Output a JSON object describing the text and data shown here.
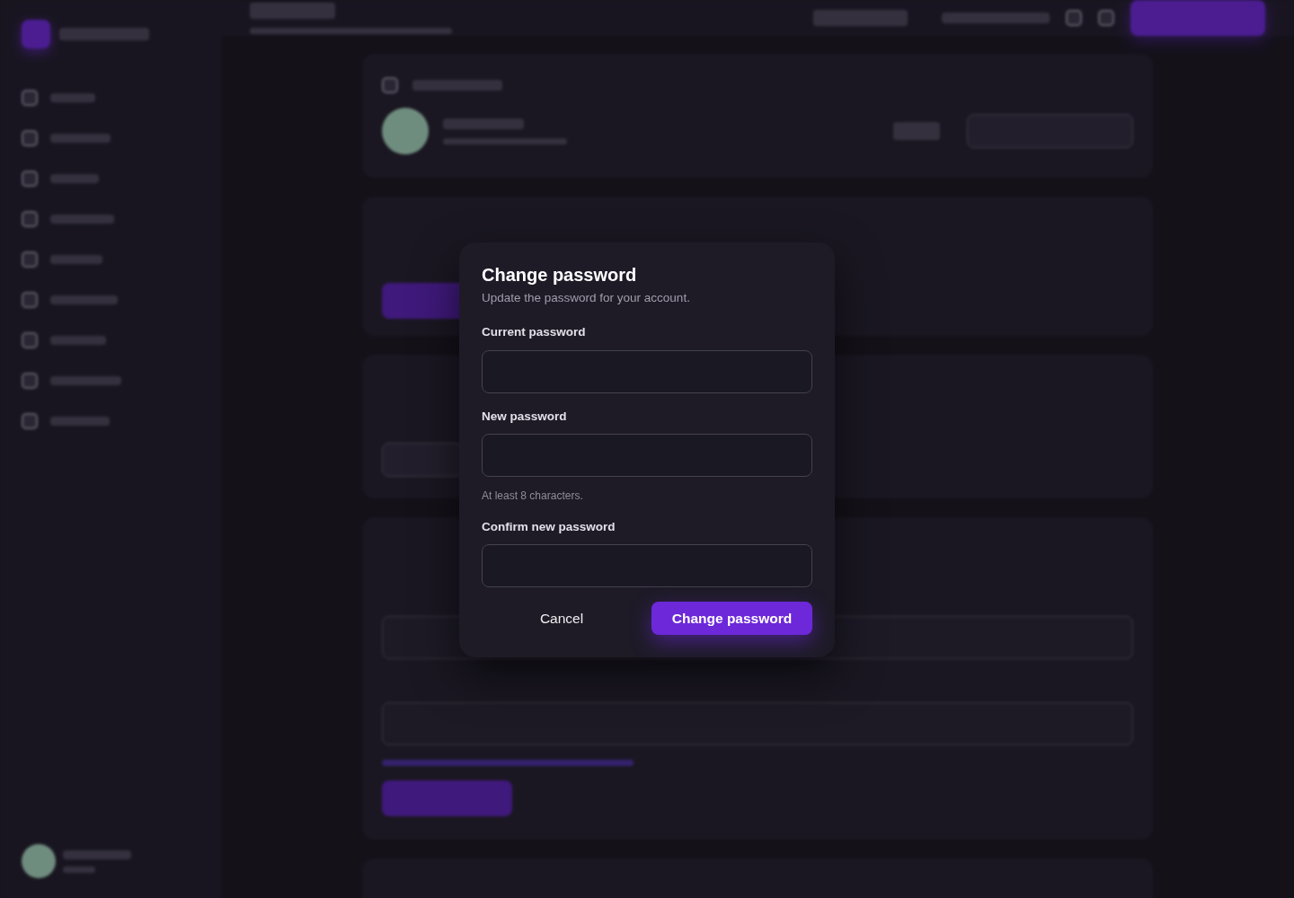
{
  "dialog": {
    "title": "Change password",
    "subtitle": "Update the password for your account.",
    "fields": [
      {
        "label": "Current password"
      },
      {
        "label": "New password",
        "hint": "At least 8 characters."
      },
      {
        "label": "Confirm new password"
      }
    ],
    "cancel": "Cancel",
    "submit": "Change password"
  }
}
